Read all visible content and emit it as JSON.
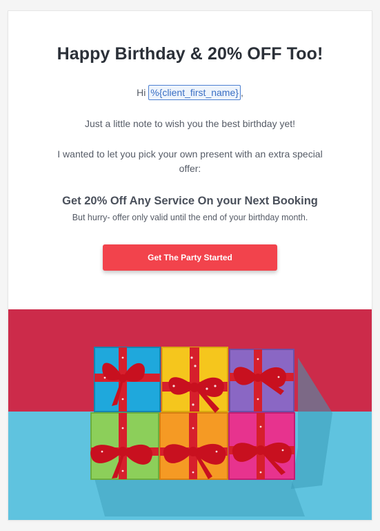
{
  "email": {
    "headline": "Happy Birthday & 20% OFF Too!",
    "greeting_prefix": "Hi ",
    "merge_tag": "%{client_first_name}",
    "greeting_suffix": ",",
    "note": "Just a little note to wish you the best birthday yet!",
    "offer_intro": "I wanted to let you pick your own present with an extra special offer:",
    "offer_heading": "Get 20% Off Any Service On your Next Booking",
    "offer_sub": "But hurry- offer only valid until the end of your birthday month.",
    "cta_label": "Get The Party Started"
  },
  "hero": {
    "icon": "gift-boxes-image",
    "colors": {
      "wall": "#cc2b4a",
      "floor": "#5fc3df",
      "ribbon": "#d61f2c",
      "box_blue": "#1fa8dc",
      "box_yellow": "#f5c61d",
      "box_purple": "#8a67c4",
      "box_green": "#8ccf5a",
      "box_orange": "#f59a24",
      "box_pink": "#e7338e"
    }
  },
  "colors": {
    "button": "#f2434c",
    "headline": "#2b3038",
    "body_text": "#555b66"
  }
}
